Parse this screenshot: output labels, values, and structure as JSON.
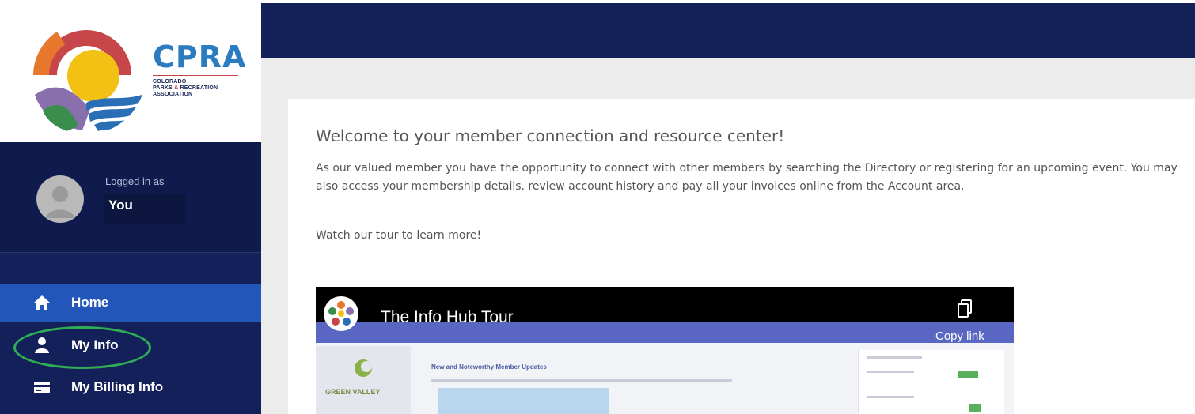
{
  "logo": {
    "name": "CPRA",
    "sub1": "COLORADO",
    "sub2a": "PARKS ",
    "sub2amp": "&",
    "sub2b": " RECREATION",
    "sub3": "ASSOCIATION"
  },
  "user": {
    "logged_in_label": "Logged in as",
    "name": "You"
  },
  "nav": {
    "items": [
      {
        "label": "Home",
        "icon": "home-icon",
        "active": true
      },
      {
        "label": "My Info",
        "icon": "user-icon",
        "active": false
      },
      {
        "label": "My Billing Info",
        "icon": "credit-card-icon",
        "active": false
      }
    ]
  },
  "main": {
    "heading": "Welcome to your member connection and resource center!",
    "paragraph": "As our valued member you have the opportunity to connect with other members by searching the Directory or registering for an upcoming event. You may also access your membership details. review account history and pay all your invoices online from the Account area.",
    "tour_text": "Watch our tour to learn more!"
  },
  "video": {
    "title": "The Info Hub Tour",
    "copy_label": "Copy link",
    "inner_logo_text": "GREEN VALLEY",
    "inner_heading": "New and Noteworthy Member Updates"
  },
  "colors": {
    "sidebar": "#14205a",
    "topbar": "#152159",
    "active_nav": "#2256b8",
    "highlight_oval": "#2fae55",
    "brand_blue": "#2a7bbf"
  }
}
